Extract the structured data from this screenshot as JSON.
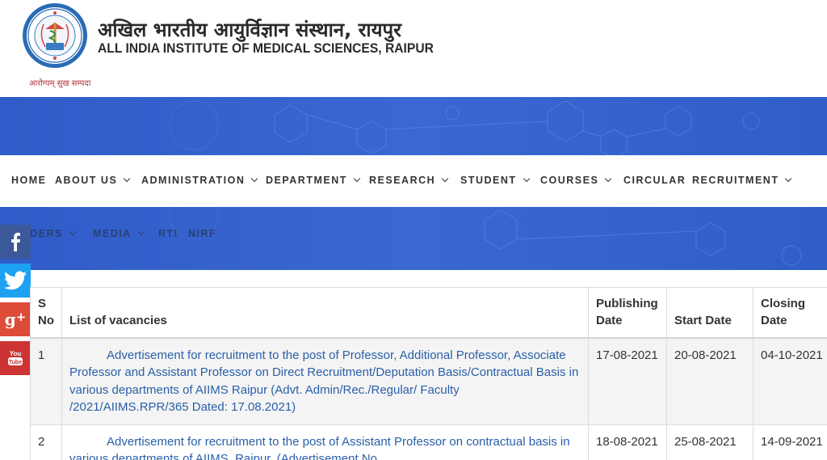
{
  "header": {
    "title_hindi": "अखिल भारतीय आयुर्विज्ञान संस्थान, रायपुर",
    "title_english": "ALL INDIA INSTITUTE OF MEDICAL SCIENCES, RAIPUR",
    "motto": "आरोग्यम् सुख सम्पदा",
    "logo_icon": "aiims-emblem-icon"
  },
  "nav": {
    "items": [
      {
        "label": "HOME",
        "has_dropdown": false
      },
      {
        "label": "ABOUT US",
        "has_dropdown": true
      },
      {
        "label": "ADMINISTRATION",
        "has_dropdown": true
      },
      {
        "label": "DEPARTMENT",
        "has_dropdown": true
      },
      {
        "label": "RESEARCH",
        "has_dropdown": true
      },
      {
        "label": "STUDENT",
        "has_dropdown": true
      },
      {
        "label": "COURSES",
        "has_dropdown": true
      },
      {
        "label": "CIRCULAR",
        "has_dropdown": false
      },
      {
        "label": "RECRUITMENT",
        "has_dropdown": true
      }
    ],
    "second_row": [
      {
        "label": "TENDERS",
        "has_dropdown": true
      },
      {
        "label": "MEDIA",
        "has_dropdown": true
      },
      {
        "label": "RTI",
        "has_dropdown": false
      },
      {
        "label": "NIRF",
        "has_dropdown": false
      }
    ]
  },
  "social": [
    "facebook-icon",
    "twitter-icon",
    "google-plus-icon",
    "youtube-icon"
  ],
  "colors": {
    "banner": "#3463cc",
    "link": "#2a5fa8",
    "facebook": "#3b5998",
    "twitter": "#1da1f2",
    "google_plus": "#dd4b39",
    "youtube": "#cc3333"
  },
  "table": {
    "headers": {
      "sno_line1": "S",
      "sno_line2": "No",
      "vacancies": "List of vacancies",
      "publishing_line1": "Publishing",
      "publishing_line2": "Date",
      "start": "Start Date",
      "closing_line1": "Closing",
      "closing_line2": "Date"
    },
    "rows": [
      {
        "sno": "1",
        "title": "Advertisement for recruitment to the post of Professor, Additional Professor, Associate Professor and Assistant Professor on Direct Recruitment/Deputation Basis/Contractual Basis in various departments of AIIMS Raipur (Advt. Admin/Rec./Regular/ Faculty /2021/AIIMS.RPR/365 Dated: 17.08.2021)",
        "publishing_date": "17-08-2021",
        "start_date": "20-08-2021",
        "closing_date": "04-10-2021"
      },
      {
        "sno": "2",
        "title": "Advertisement for recruitment to the post of Assistant Professor on contractual basis in various departments of AIIMS, Raipur. (Advertisement No.",
        "publishing_date": "18-08-2021",
        "start_date": "25-08-2021",
        "closing_date": "14-09-2021"
      }
    ]
  }
}
